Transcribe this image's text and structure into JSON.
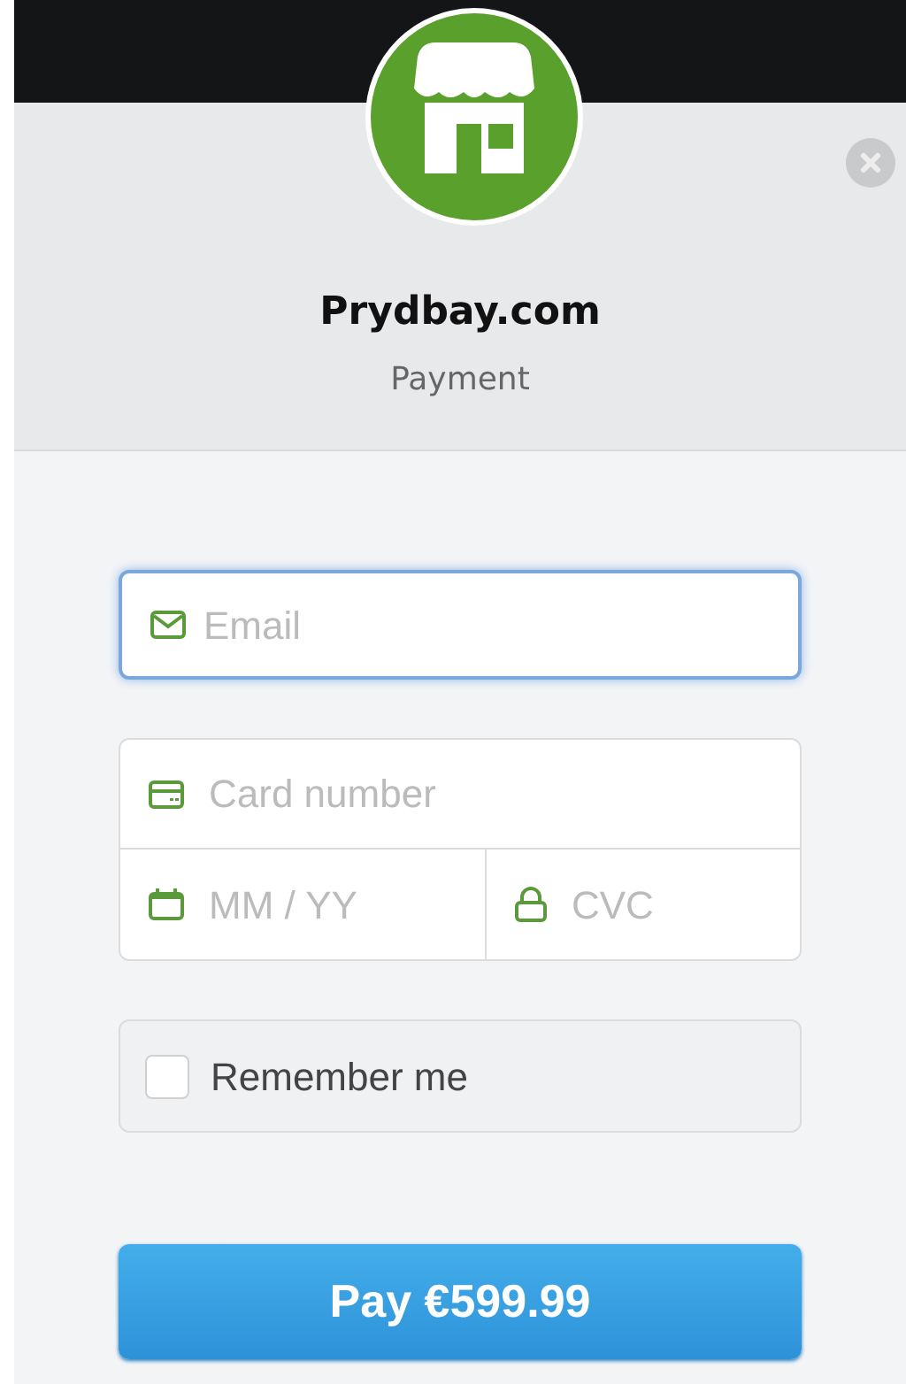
{
  "header": {
    "title": "Prydbay.com",
    "subtitle": "Payment"
  },
  "email": {
    "placeholder": "Email",
    "focused": true
  },
  "card": {
    "number_placeholder": "Card number",
    "expiry_placeholder": "MM / YY",
    "cvc_placeholder": "CVC"
  },
  "remember": {
    "label": "Remember me",
    "checked": false
  },
  "pay_button": {
    "label": "Pay €599.99"
  }
}
